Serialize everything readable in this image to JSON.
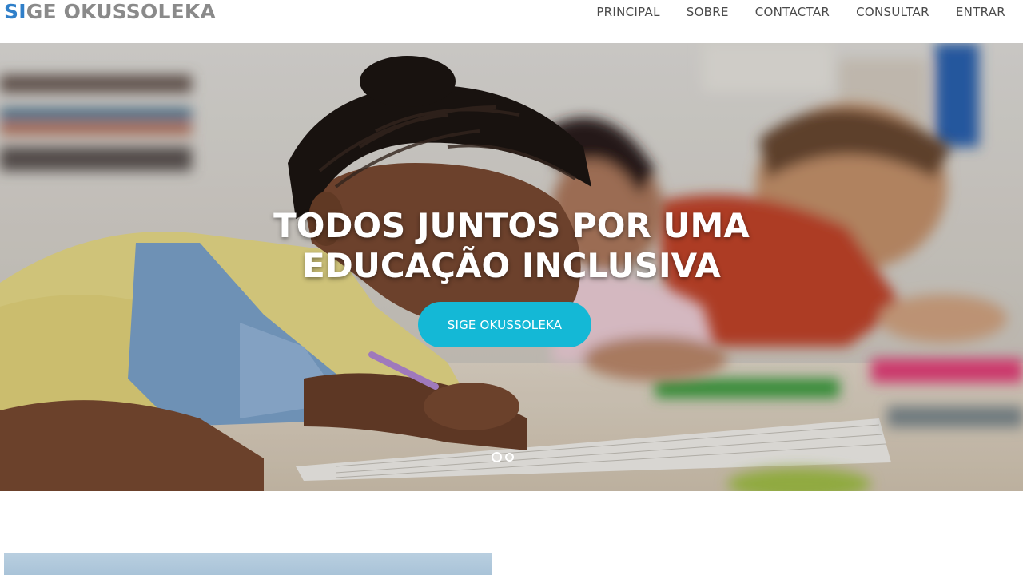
{
  "header": {
    "logo_accent": "SI",
    "logo_rest": "GE OKUSSOLEKA",
    "nav": [
      "PRINCIPAL",
      "SOBRE",
      "CONTACTAR",
      "CONSULTAR",
      "ENTRAR"
    ]
  },
  "hero": {
    "title_line1": "TODOS JUNTOS POR UMA",
    "title_line2": "EDUCAÇÃO INCLUSIVA",
    "cta_label": "SIGE OKUSSOLEKA",
    "slide_count": 2,
    "active_slide": 1
  },
  "colors": {
    "logo_accent": "#2f7fc9",
    "logo_text": "#8a8a8a",
    "nav_text": "#4a4a4a",
    "cta_background": "#14b8d6"
  }
}
